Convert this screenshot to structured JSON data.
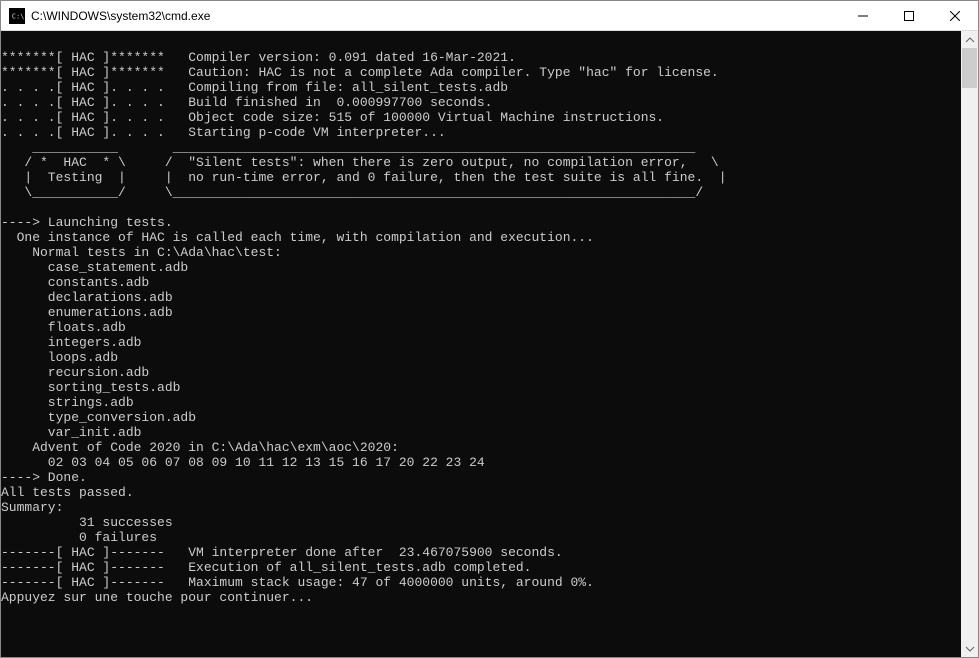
{
  "window": {
    "title": "C:\\WINDOWS\\system32\\cmd.exe"
  },
  "console": {
    "lines": [
      "",
      "*******[ HAC ]*******   Compiler version: 0.091 dated 16-Mar-2021.",
      "*******[ HAC ]*******   Caution: HAC is not a complete Ada compiler. Type \"hac\" for license.",
      ". . . .[ HAC ]. . . .   Compiling from file: all_silent_tests.adb",
      ". . . .[ HAC ]. . . .   Build finished in  0.000997700 seconds.",
      ". . . .[ HAC ]. . . .   Object code size: 515 of 100000 Virtual Machine instructions.",
      ". . . .[ HAC ]. . . .   Starting p-code VM interpreter...",
      "    ___________       ___________________________________________________________________",
      "   / *  HAC  * \\     /  \"Silent tests\": when there is zero output, no compilation error,   \\",
      "   |  Testing  |     |  no run-time error, and 0 failure, then the test suite is all fine.  |",
      "   \\___________/     \\___________________________________________________________________/",
      "",
      "----> Launching tests.",
      "  One instance of HAC is called each time, with compilation and execution...",
      "    Normal tests in C:\\Ada\\hac\\test:",
      "      case_statement.adb",
      "      constants.adb",
      "      declarations.adb",
      "      enumerations.adb",
      "      floats.adb",
      "      integers.adb",
      "      loops.adb",
      "      recursion.adb",
      "      sorting_tests.adb",
      "      strings.adb",
      "      type_conversion.adb",
      "      var_init.adb",
      "    Advent of Code 2020 in C:\\Ada\\hac\\exm\\aoc\\2020:",
      "      02 03 04 05 06 07 08 09 10 11 12 13 15 16 17 20 22 23 24",
      "----> Done.",
      "All tests passed.",
      "Summary:",
      "          31 successes",
      "          0 failures",
      "-------[ HAC ]-------   VM interpreter done after  23.467075900 seconds.",
      "-------[ HAC ]-------   Execution of all_silent_tests.adb completed.",
      "-------[ HAC ]-------   Maximum stack usage: 47 of 4000000 units, around 0%.",
      "Appuyez sur une touche pour continuer..."
    ]
  }
}
